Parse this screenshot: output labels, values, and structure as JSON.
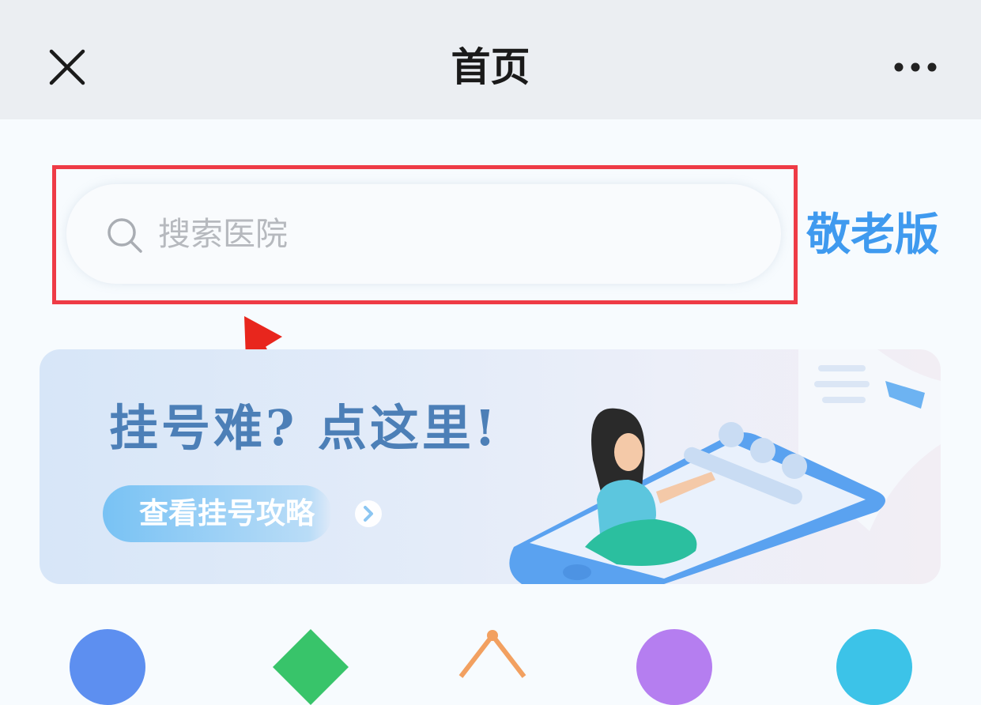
{
  "header": {
    "title": "首页",
    "close_icon": "close-icon",
    "more_icon": "more-dots-icon"
  },
  "search": {
    "placeholder": "搜索医院",
    "icon": "search-icon"
  },
  "elder_mode_label": "敬老版",
  "banner": {
    "headline": "挂号难? 点这里!",
    "cta_label": "查看挂号攻略",
    "cta_icon": "chevron-right-circle-icon"
  },
  "colors": {
    "accent": "#3f9aef",
    "highlight": "#ee3b46",
    "banner_text": "#4c7fb7"
  },
  "quick_icons": [
    "blue-circle-icon",
    "green-diamond-icon",
    "orange-icon",
    "purple-circle-icon",
    "cyan-circle-icon"
  ]
}
